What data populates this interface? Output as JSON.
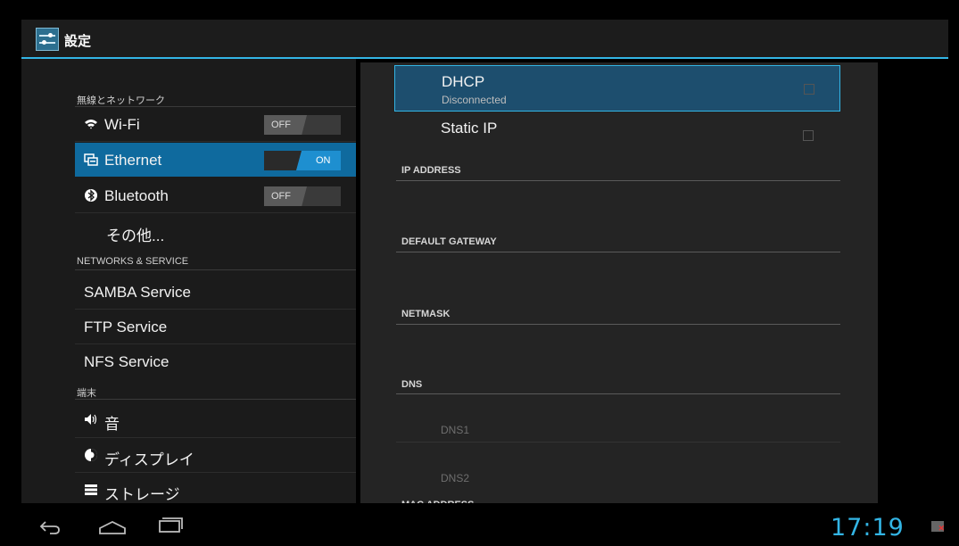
{
  "app": {
    "title": "設定"
  },
  "sidebar": {
    "section_wireless": "無線とネットワーク",
    "wifi": {
      "label": "Wi-Fi",
      "toggle": "OFF"
    },
    "ethernet": {
      "label": "Ethernet",
      "toggle": "ON"
    },
    "bluetooth": {
      "label": "Bluetooth",
      "toggle": "OFF"
    },
    "more": "その他...",
    "section_networks": "NETWORKS & SERVICE",
    "samba": "SAMBA Service",
    "ftp": "FTP Service",
    "nfs": "NFS Service",
    "section_device": "端末",
    "sound": "音",
    "display": "ディスプレイ",
    "storage": "ストレージ"
  },
  "ethernet_settings": {
    "dhcp": {
      "title": "DHCP",
      "status": "Disconnected"
    },
    "static": {
      "title": "Static IP"
    },
    "ip_address_label": "IP ADDRESS",
    "gateway_label": "DEFAULT GATEWAY",
    "netmask_label": "NETMASK",
    "dns_label": "DNS",
    "dns1_placeholder": "DNS1",
    "dns2_placeholder": "DNS2",
    "mac_label": "MAC ADDRESS"
  },
  "status_bar": {
    "time": "17:19"
  },
  "icons": [
    "settings-app-icon",
    "wifi-icon",
    "ethernet-icon",
    "bluetooth-icon",
    "sound-icon",
    "display-icon",
    "storage-icon",
    "back-icon",
    "home-icon",
    "recent-apps-icon",
    "ethernet-disconnected-icon"
  ],
  "colors": {
    "accent": "#33b5e5",
    "selected": "#0f6a9e"
  }
}
